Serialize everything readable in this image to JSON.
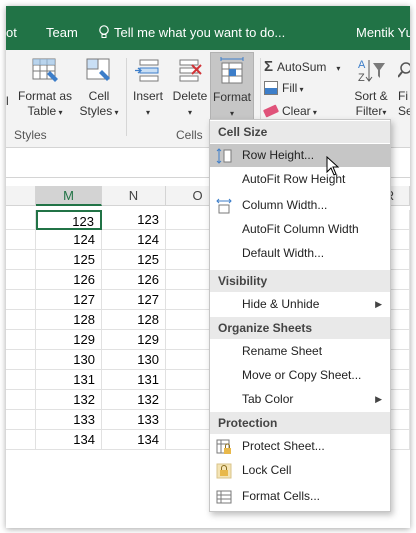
{
  "ribbon_tabs": {
    "partial_tab": "ot",
    "team": "Team",
    "tell_me": "Tell me what you want to do...",
    "user": "Mentik Yu"
  },
  "ribbon": {
    "format_as_table": [
      "Format as",
      "Table"
    ],
    "cell_styles": [
      "Cell",
      "Styles"
    ],
    "insert": "Insert",
    "delete": "Delete",
    "format": "Format",
    "autosum": "AutoSum",
    "fill": "Fill",
    "clear": "Clear",
    "sort_filter": [
      "Sort &",
      "Filter"
    ],
    "find_partial": [
      "Fi",
      "Se"
    ],
    "group_styles": "Styles",
    "group_cells": "Cells"
  },
  "grid": {
    "columns": [
      "M",
      "N",
      "O",
      "R"
    ],
    "selected_column": "M",
    "rows": [
      [
        "123",
        "123"
      ],
      [
        "124",
        "124"
      ],
      [
        "125",
        "125"
      ],
      [
        "126",
        "126"
      ],
      [
        "127",
        "127"
      ],
      [
        "128",
        "128"
      ],
      [
        "129",
        "129"
      ],
      [
        "130",
        "130"
      ],
      [
        "131",
        "131"
      ],
      [
        "132",
        "132"
      ],
      [
        "133",
        "133"
      ],
      [
        "134",
        "134"
      ]
    ]
  },
  "menu": {
    "cell_size_header": "Cell Size",
    "row_height": "Row Height...",
    "autofit_row_height": "AutoFit Row Height",
    "column_width": "Column Width...",
    "autofit_column_width": "AutoFit Column Width",
    "default_width": "Default Width...",
    "visibility_header": "Visibility",
    "hide_unhide": "Hide & Unhide",
    "organize_header": "Organize Sheets",
    "rename_sheet": "Rename Sheet",
    "move_copy": "Move or Copy Sheet...",
    "tab_color": "Tab Color",
    "protection_header": "Protection",
    "protect_sheet": "Protect Sheet...",
    "lock_cell": "Lock Cell",
    "format_cells": "Format Cells..."
  },
  "colors": {
    "excel_green": "#217346",
    "ribbon_bg": "#f3f3f3",
    "menu_highlight": "#c6c6c6"
  }
}
